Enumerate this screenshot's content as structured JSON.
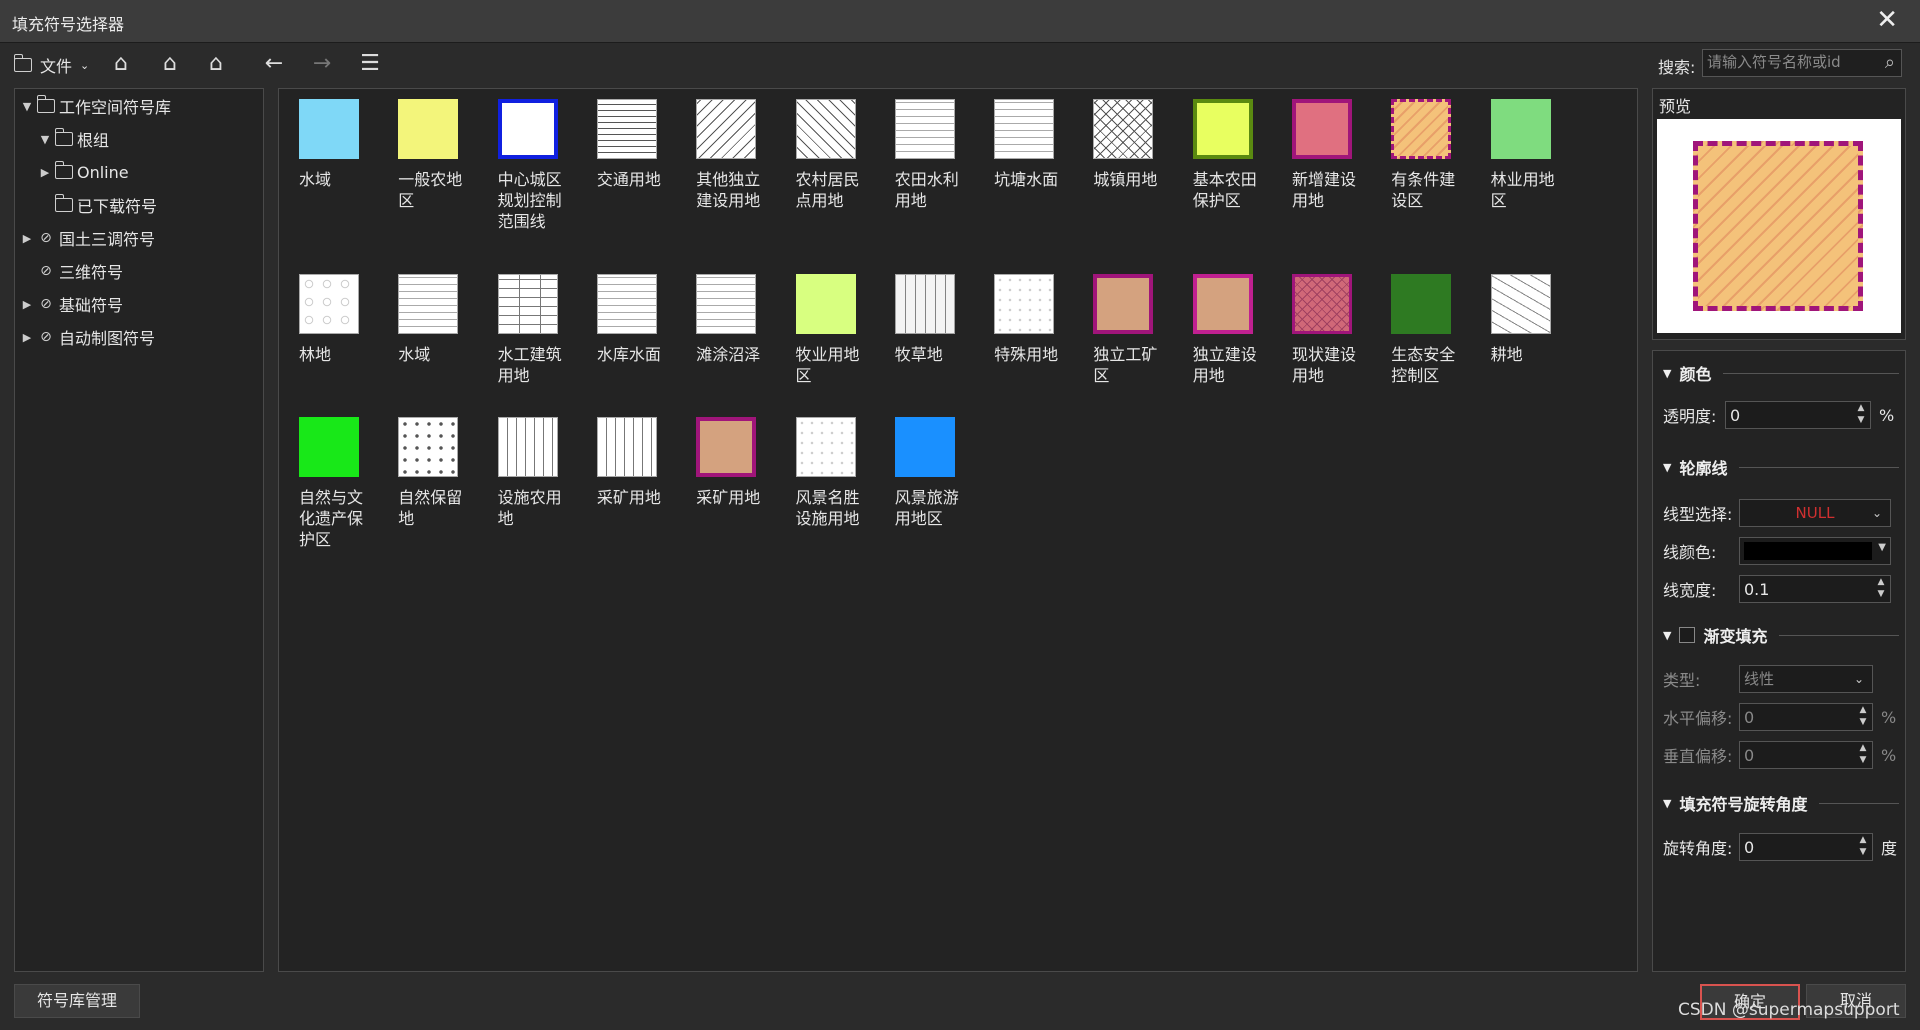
{
  "window": {
    "title": "填充符号选择器",
    "close": "✕"
  },
  "toolbar": {
    "file_label": "文件",
    "search_label": "搜索:",
    "search_placeholder": "请输入符号名称或id",
    "search_value": ""
  },
  "tree": [
    {
      "label": "工作空间符号库",
      "indent": 0,
      "expander": "▼",
      "icon": "folder-icon"
    },
    {
      "label": "根组",
      "indent": 1,
      "expander": "▼",
      "icon": "folder-icon"
    },
    {
      "label": "Online",
      "indent": 1,
      "expander": "▶",
      "icon": "folder-icon"
    },
    {
      "label": "已下载符号",
      "indent": 1,
      "expander": "",
      "icon": "folder-icon"
    },
    {
      "label": "国土三调符号",
      "indent": 0,
      "expander": "▶",
      "icon": "link-icon"
    },
    {
      "label": "三维符号",
      "indent": 0,
      "expander": "",
      "icon": "link-icon"
    },
    {
      "label": "基础符号",
      "indent": 0,
      "expander": "▶",
      "icon": "link-icon"
    },
    {
      "label": "自动制图符号",
      "indent": 0,
      "expander": "▶",
      "icon": "link-icon"
    }
  ],
  "symbols": [
    {
      "label": "水域",
      "style": "solid",
      "color": "#7fd8f7"
    },
    {
      "label": "一般农地区",
      "style": "solid",
      "color": "#f3f57b"
    },
    {
      "label": "中心城区规划控制范围线",
      "style": "outline",
      "color": "#ffffff",
      "border": "#1020e0"
    },
    {
      "label": "交通用地",
      "style": "hatch-h"
    },
    {
      "label": "其他独立建设用地",
      "style": "hatch-d2"
    },
    {
      "label": "农村居民点用地",
      "style": "hatch-d1"
    },
    {
      "label": "农田水利用地",
      "style": "hatch-dash"
    },
    {
      "label": "坑塘水面",
      "style": "hatch-dash"
    },
    {
      "label": "城镇用地",
      "style": "cross"
    },
    {
      "label": "基本农田保护区",
      "style": "outline",
      "color": "#e8ff60",
      "border": "#5a8a10"
    },
    {
      "label": "新增建设用地",
      "style": "outline",
      "color": "#e07080",
      "border": "#a0157a"
    },
    {
      "label": "有条件建设区",
      "style": "dashed-hatch",
      "color": "#f4c27a",
      "border": "#a0157a"
    },
    {
      "label": "林业用地区",
      "style": "solid",
      "color": "#7fdc7f"
    },
    {
      "label": "林地",
      "style": "circles"
    },
    {
      "label": "水域",
      "style": "hatch-dash"
    },
    {
      "label": "水工建筑用地",
      "style": "hv"
    },
    {
      "label": "水库水面",
      "style": "hatch-dash"
    },
    {
      "label": "滩涂沼泽",
      "style": "hatch-dash"
    },
    {
      "label": "牧业用地区",
      "style": "solid",
      "color": "#d8ff80"
    },
    {
      "label": "牧草地",
      "style": "vdash"
    },
    {
      "label": "特殊用地",
      "style": "light"
    },
    {
      "label": "独立工矿区",
      "style": "outline",
      "color": "#d4a27f",
      "border": "#a0157a"
    },
    {
      "label": "独立建设用地",
      "style": "outline",
      "color": "#d4a27f",
      "border": "#c02090"
    },
    {
      "label": "现状建设用地",
      "style": "cross-color",
      "color": "#d06878",
      "border": "#a0157a"
    },
    {
      "label": "生态安全控制区",
      "style": "solid",
      "color": "#2e7a22"
    },
    {
      "label": "耕地",
      "style": "mixed"
    },
    {
      "label": "自然与文化遗产保护区",
      "style": "solid",
      "color": "#18e818"
    },
    {
      "label": "自然保留地",
      "style": "dots"
    },
    {
      "label": "设施农用地",
      "style": "vlines"
    },
    {
      "label": "采矿用地",
      "style": "vlines"
    },
    {
      "label": "采矿用地",
      "style": "outline",
      "color": "#d4a27f",
      "border": "#a0157a"
    },
    {
      "label": "风景名胜设施用地",
      "style": "light"
    },
    {
      "label": "风景旅游用地区",
      "style": "solid",
      "color": "#1a90ff"
    }
  ],
  "preview": {
    "title": "预览"
  },
  "props": {
    "color_section": "颜色",
    "transparency_label": "透明度:",
    "transparency_value": "0",
    "percent": "%",
    "outline_section": "轮廓线",
    "line_type_label": "线型选择:",
    "line_type_value": "NULL",
    "line_color_label": "线颜色:",
    "line_color": "#000000",
    "line_width_label": "线宽度:",
    "line_width_value": "0.1",
    "gradient_section": "渐变填充",
    "type_label": "类型:",
    "type_value": "线性",
    "h_offset_label": "水平偏移:",
    "h_offset_value": "0",
    "v_offset_label": "垂直偏移:",
    "v_offset_value": "0",
    "rotate_section": "填充符号旋转角度",
    "rotate_label": "旋转角度:",
    "rotate_value": "0",
    "deg": "度"
  },
  "footer": {
    "manage": "符号库管理",
    "ok": "确定",
    "cancel": "取消",
    "watermark": "CSDN @supermapsupport"
  }
}
